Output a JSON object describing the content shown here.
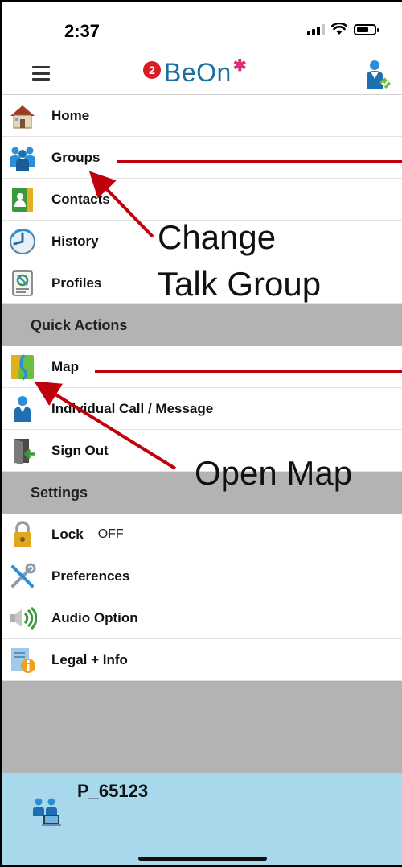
{
  "status_bar": {
    "time": "2:37"
  },
  "header": {
    "logo_text": "BeOn",
    "notification_count": "2"
  },
  "menu": {
    "items": [
      {
        "label": "Home",
        "icon": "house-icon"
      },
      {
        "label": "Groups",
        "icon": "group-people-icon"
      },
      {
        "label": "Contacts",
        "icon": "contacts-book-icon"
      },
      {
        "label": "History",
        "icon": "history-clock-icon"
      },
      {
        "label": "Profiles",
        "icon": "profiles-document-icon"
      }
    ],
    "quick_actions_header": "Quick Actions",
    "quick_actions": [
      {
        "label": "Map",
        "icon": "map-icon"
      },
      {
        "label": "Individual Call / Message",
        "icon": "person-icon"
      },
      {
        "label": "Sign Out",
        "icon": "sign-out-door-icon"
      }
    ],
    "settings_header": "Settings",
    "settings": [
      {
        "label": "Lock",
        "value": "OFF",
        "icon": "padlock-icon"
      },
      {
        "label": "Preferences",
        "icon": "tools-wrench-icon"
      },
      {
        "label": "Audio Option",
        "icon": "speaker-icon"
      },
      {
        "label": "Legal + Info",
        "icon": "info-document-icon"
      }
    ]
  },
  "footer": {
    "user_id": "P_65123"
  },
  "annotations": {
    "change_talk_group_line1": "Change",
    "change_talk_group_line2": "Talk Group",
    "open_map": "Open Map"
  },
  "colors": {
    "accent_blue": "#1a6f9e",
    "section_gray": "#b3b3b3",
    "footer_blue": "#a8d8ec",
    "annotation_red": "#c0000a"
  }
}
